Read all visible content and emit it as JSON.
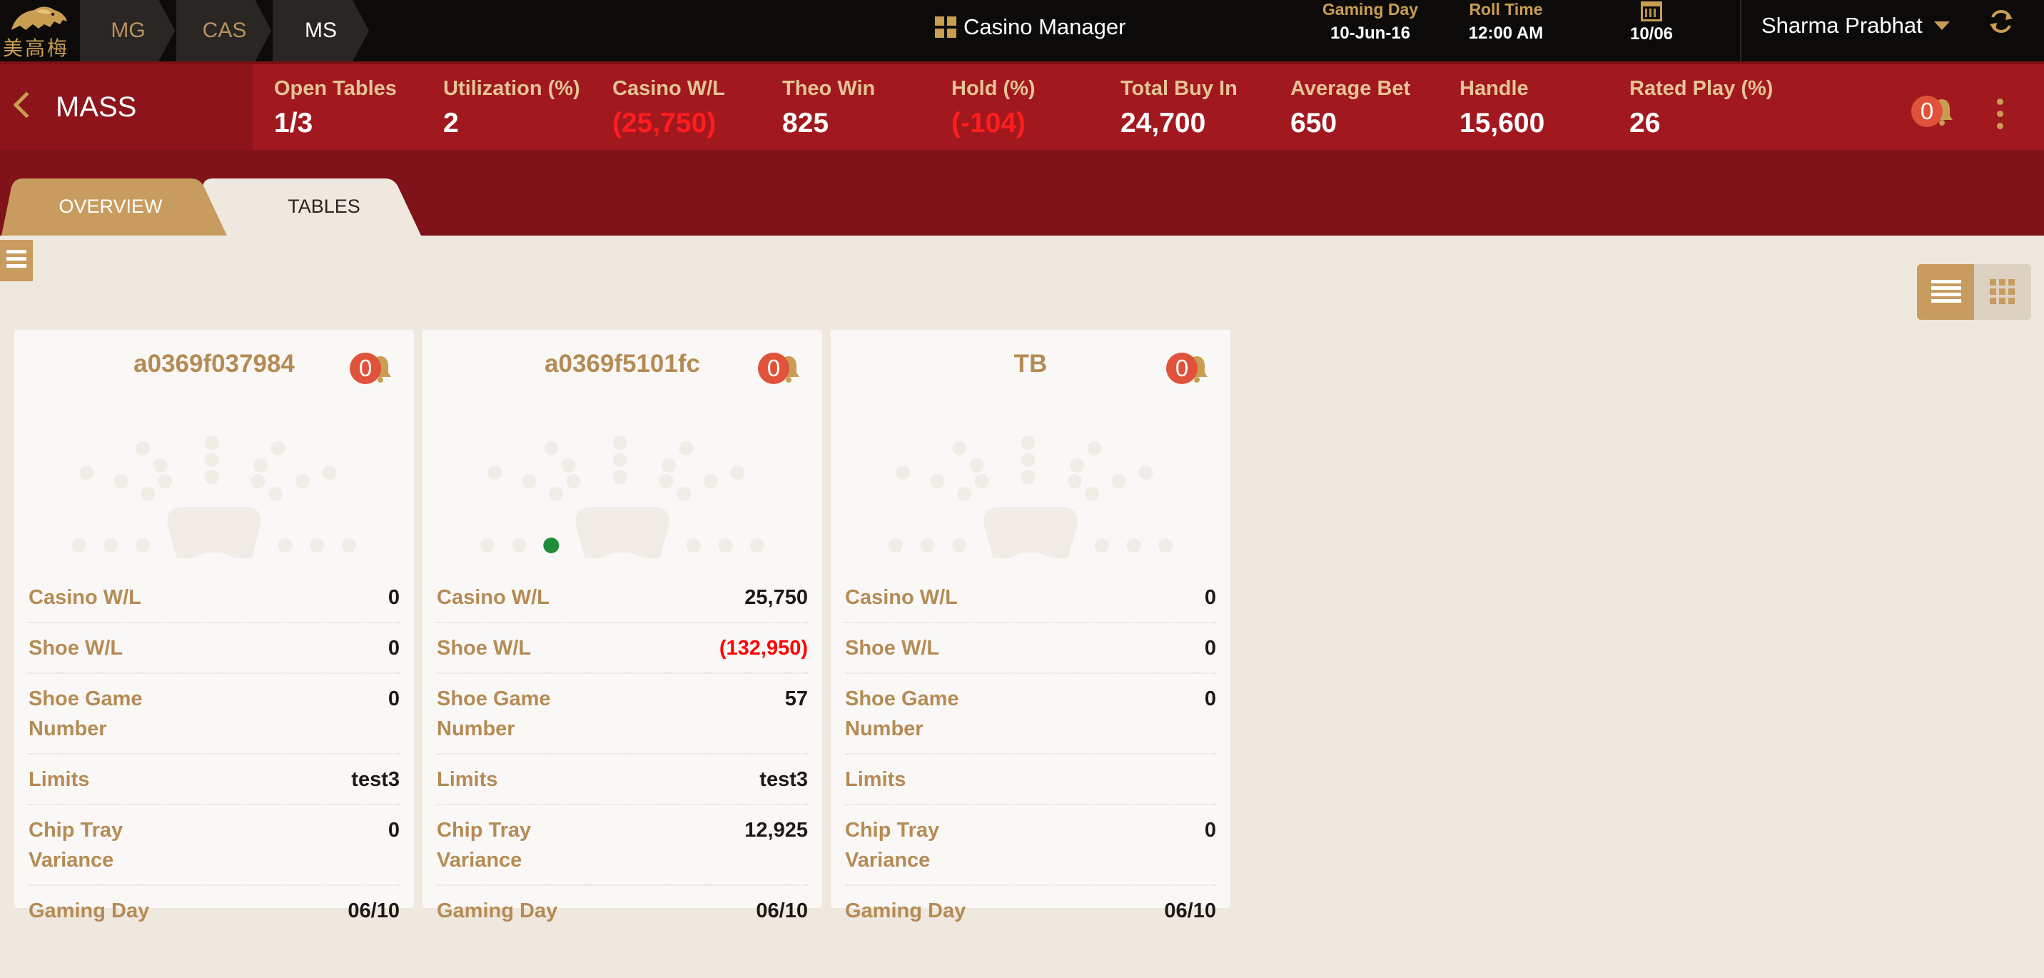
{
  "brand": {
    "logo_text": "美高梅"
  },
  "breadcrumbs": [
    {
      "label": "MG",
      "active": false
    },
    {
      "label": "CAS",
      "active": false
    },
    {
      "label": "MS",
      "active": true
    }
  ],
  "app_title": "Casino Manager",
  "header_meta": {
    "gaming_day_label": "Gaming Day",
    "gaming_day_value": "10-Jun-16",
    "roll_time_label": "Roll Time",
    "roll_time_value": "12:00 AM",
    "calendar_value": "10/06"
  },
  "user": {
    "name": "Sharma Prabhat"
  },
  "section": {
    "title": "MASS"
  },
  "stats": [
    {
      "label": "Open Tables",
      "value": "1/3",
      "negative": false
    },
    {
      "label": "Utilization (%)",
      "value": "2",
      "negative": false
    },
    {
      "label": "Casino W/L",
      "value": "(25,750)",
      "negative": true
    },
    {
      "label": "Theo Win",
      "value": "825",
      "negative": false
    },
    {
      "label": "Hold (%)",
      "value": "(-104)",
      "negative": true
    },
    {
      "label": "Total Buy In",
      "value": "24,700",
      "negative": false
    },
    {
      "label": "Average Bet",
      "value": "650",
      "negative": false
    },
    {
      "label": "Handle",
      "value": "15,600",
      "negative": false
    },
    {
      "label": "Rated Play (%)",
      "value": "26",
      "negative": false
    }
  ],
  "alerts": {
    "count": "0"
  },
  "tabs": [
    {
      "label": "OVERVIEW",
      "active": true
    },
    {
      "label": "TABLES",
      "active": false
    }
  ],
  "colors": {
    "accent": "#c89c5e",
    "header_red": "#a2181f",
    "negative": "#ff0000",
    "occupied_seat": "#1e8c3a"
  },
  "tables": [
    {
      "name": "a0369f037984",
      "alert_count": "0",
      "occupied_seat_index": null,
      "rows": [
        {
          "label": "Casino W/L",
          "value": "0",
          "negative": false
        },
        {
          "label": "Shoe W/L",
          "value": "0",
          "negative": false
        },
        {
          "label": "Shoe Game Number",
          "value": "0",
          "negative": false
        },
        {
          "label": "Limits",
          "value": "test3",
          "negative": false
        },
        {
          "label": "Chip Tray Variance",
          "value": "0",
          "negative": false
        },
        {
          "label": "Gaming Day",
          "value": "06/10",
          "negative": false
        }
      ]
    },
    {
      "name": "a0369f5101fc",
      "alert_count": "0",
      "occupied_seat_index": 2,
      "rows": [
        {
          "label": "Casino W/L",
          "value": "25,750",
          "negative": false
        },
        {
          "label": "Shoe W/L",
          "value": "(132,950)",
          "negative": true
        },
        {
          "label": "Shoe Game Number",
          "value": "57",
          "negative": false
        },
        {
          "label": "Limits",
          "value": "test3",
          "negative": false
        },
        {
          "label": "Chip Tray Variance",
          "value": "12,925",
          "negative": false
        },
        {
          "label": "Gaming Day",
          "value": "06/10",
          "negative": false
        }
      ]
    },
    {
      "name": "TB",
      "alert_count": "0",
      "occupied_seat_index": null,
      "rows": [
        {
          "label": "Casino W/L",
          "value": "0",
          "negative": false
        },
        {
          "label": "Shoe W/L",
          "value": "0",
          "negative": false
        },
        {
          "label": "Shoe Game Number",
          "value": "0",
          "negative": false
        },
        {
          "label": "Limits",
          "value": "",
          "negative": false
        },
        {
          "label": "Chip Tray Variance",
          "value": "0",
          "negative": false
        },
        {
          "label": "Gaming Day",
          "value": "06/10",
          "negative": false
        }
      ]
    }
  ]
}
